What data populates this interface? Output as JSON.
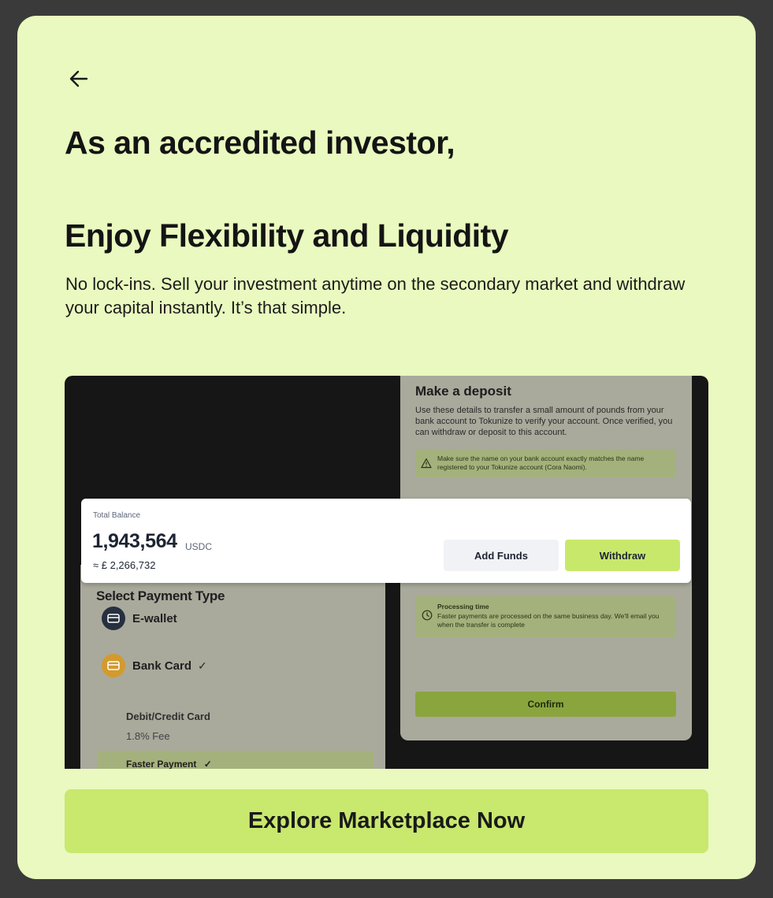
{
  "header": {
    "back_icon": "arrow-left-icon",
    "title_line1": "As an accredited investor,",
    "title_line2": "Enjoy Flexibility and Liquidity",
    "description": "No lock-ins. Sell your investment anytime on the secondary market and withdraw your capital instantly. It’s that simple."
  },
  "preview": {
    "deposit": {
      "title": "Make a deposit",
      "description": "Use these details to transfer a small amount of pounds from your bank account to Tokunize to verify your account. Once verified, you can withdraw or deposit to this account.",
      "warning": "Make sure the name on your bank account exactly matches the name registered to your Tokunize account (Cora Naomi).",
      "warning_icon": "warning-icon",
      "processing_title": "Processing time",
      "processing_text": "Faster payments are processed on the same business day. We'll email you when the transfer is complete",
      "processing_icon": "clock-icon",
      "confirm_label": "Confirm"
    },
    "balance": {
      "label": "Total Balance",
      "amount": "1,943,564",
      "unit": "USDC",
      "approx": "≈ £ 2,266,732",
      "add_funds_label": "Add Funds",
      "withdraw_label": "Withdraw"
    },
    "payment": {
      "title": "Select Payment Type",
      "options": [
        {
          "label": "E-wallet",
          "icon": "wallet-icon"
        },
        {
          "label": "Bank Card",
          "icon": "card-icon",
          "check": "✓"
        }
      ],
      "card_type": "Debit/Credit Card",
      "fee": "1.8% Fee",
      "faster_label": "Faster Payment",
      "faster_check": "✓"
    }
  },
  "cta": {
    "label": "Explore Marketplace Now"
  },
  "colors": {
    "background": "#e9f9bf",
    "accent": "#c9e86e",
    "dark": "#161616"
  }
}
